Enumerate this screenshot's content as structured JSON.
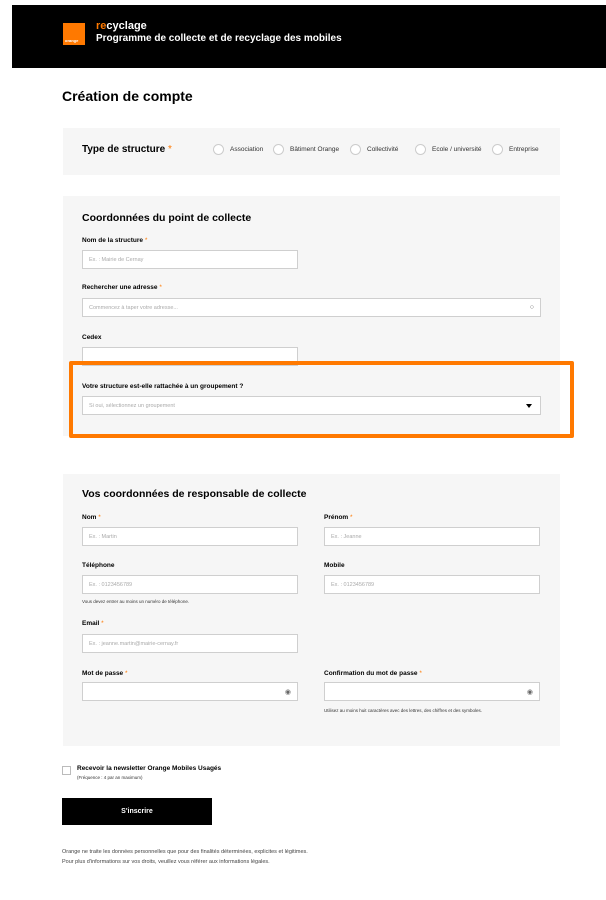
{
  "header": {
    "brand_prefix": "re",
    "brand_suffix": "cycla",
    "brand_end": "ge",
    "subtitle": "Programme de collecte et de recyclage des mobiles",
    "logo_text": "orange"
  },
  "page": {
    "title": "Création de compte"
  },
  "structure_type": {
    "label": "Type de structure",
    "required_mark": "*",
    "options": [
      "Association",
      "Bâtiment Orange",
      "Collectivité",
      "Ecole / université",
      "Entreprise"
    ]
  },
  "collection_point": {
    "title": "Coordonnées du point de collecte",
    "name_label": "Nom de la structure",
    "name_placeholder": "Ex. : Mairie de Cernay",
    "address_label": "Rechercher une adresse",
    "address_placeholder": "Commencez à taper votre adresse...",
    "cedex_label": "Cedex",
    "cedex_value": "",
    "group_label": "Votre structure est-elle rattachée à un groupement ?",
    "group_placeholder": "Si oui, sélectionnez un groupement"
  },
  "manager": {
    "title": "Vos coordonnées de responsable de collecte",
    "nom_label": "Nom",
    "nom_placeholder": "Ex. : Martin",
    "prenom_label": "Prénom",
    "prenom_placeholder": "Ex. : Jeanne",
    "tel_label": "Téléphone",
    "tel_placeholder": "Ex. : 0123456789",
    "mobile_label": "Mobile",
    "mobile_placeholder": "Ex. : 0123456789",
    "phone_note": "Vous devez entrer au moins un numéro de téléphone.",
    "email_label": "Email",
    "email_placeholder": "Ex. : jeanne.martin@mairie-cernay.fr",
    "password_label": "Mot de passe",
    "password_confirm_label": "Confirmation du mot de passe",
    "password_note": "Utilisez au moins huit caractères avec des lettres, des chiffres et des symboles."
  },
  "newsletter": {
    "label": "Recevoir la newsletter Orange Mobiles Usagés",
    "frequency": "(Fréquence : 4 par an maximum)"
  },
  "submit_label": "S'inscrire",
  "legal": {
    "line1": "Orange ne traite les données personnelles que pour des finalités déterminées, explicites et légitimes.",
    "line2": "Pour plus d'informations sur vos droits, veuillez vous référer aux informations légales."
  },
  "colors": {
    "accent": "#ff7900",
    "header_bg": "#000000",
    "panel_bg": "#f6f6f6"
  }
}
